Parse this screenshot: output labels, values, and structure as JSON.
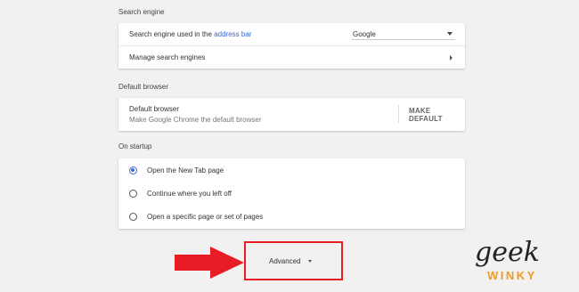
{
  "search_engine": {
    "title": "Search engine",
    "used_prefix": "Search engine used in the ",
    "used_link": "address bar",
    "selected_engine": "Google",
    "manage_label": "Manage search engines"
  },
  "default_browser": {
    "title": "Default browser",
    "label": "Default browser",
    "sublabel": "Make Google Chrome the default browser",
    "button": "MAKE DEFAULT"
  },
  "on_startup": {
    "title": "On startup",
    "options": [
      {
        "label": "Open the New Tab page",
        "selected": true
      },
      {
        "label": "Continue where you left off",
        "selected": false
      },
      {
        "label": "Open a specific page or set of pages",
        "selected": false
      }
    ]
  },
  "advanced": {
    "label": "Advanced"
  },
  "logo": {
    "top": "geek",
    "bottom": "WINKY"
  },
  "colors": {
    "link": "#3367d6",
    "radio_selected": "#3f6ad8",
    "highlight_red": "#e81c24",
    "logo_orange": "#f39a1e"
  }
}
